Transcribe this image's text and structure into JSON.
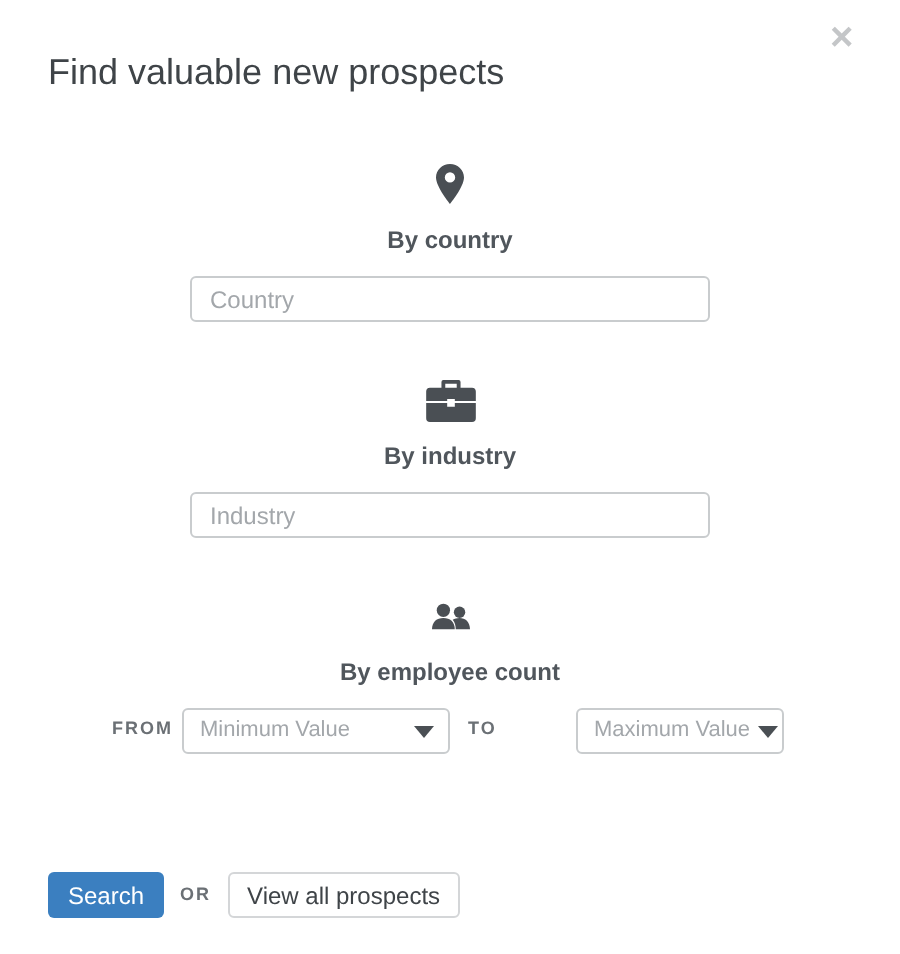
{
  "dialog": {
    "title": "Find valuable new prospects",
    "close": "×"
  },
  "filters": [
    {
      "kind": "text",
      "label": "By country",
      "placeholder": "Country"
    },
    {
      "kind": "text",
      "label": "By industry",
      "placeholder": "Industry"
    },
    {
      "kind": "range",
      "label": "By employee count",
      "from_label": "FROM",
      "min_placeholder": "Minimum Value",
      "to_label": "TO",
      "max_placeholder": "Maximum Value"
    }
  ],
  "actions": {
    "search": "Search",
    "separator": "OR",
    "view_all": "View all prospects"
  }
}
